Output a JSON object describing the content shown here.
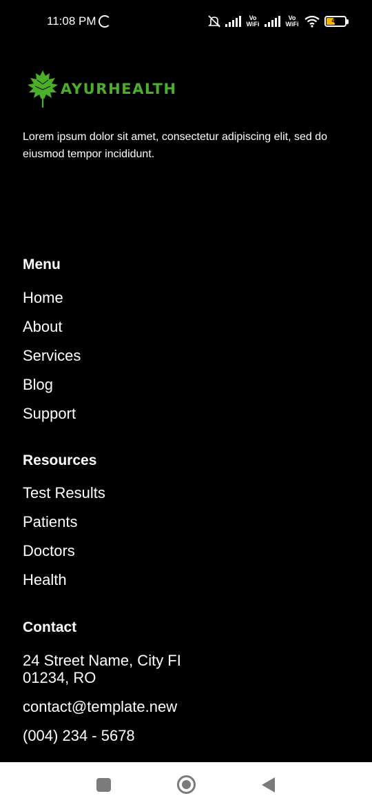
{
  "status_bar": {
    "time": "11:08 PM",
    "vowifi_1": "Vo WiFi",
    "vowifi_2": "Vo WiFi",
    "battery": "46"
  },
  "brand": {
    "name": "AYURHEALTH",
    "color": "#4caf2a"
  },
  "intro": "Lorem ipsum dolor sit amet, consectetur adipiscing elit, sed do eiusmod tempor incididunt.",
  "menu": {
    "title": "Menu",
    "items": [
      "Home",
      "About",
      "Services",
      "Blog",
      "Support"
    ]
  },
  "resources": {
    "title": "Resources",
    "items": [
      "Test Results",
      "Patients",
      "Doctors",
      "Health"
    ]
  },
  "contact": {
    "title": "Contact",
    "address": "24 Street Name, City FI 01234, RO",
    "email": "contact@template.new",
    "phone": "(004) 234 - 5678"
  },
  "nav_bar": {
    "icons": [
      "recents-icon",
      "home-icon",
      "back-icon"
    ]
  }
}
